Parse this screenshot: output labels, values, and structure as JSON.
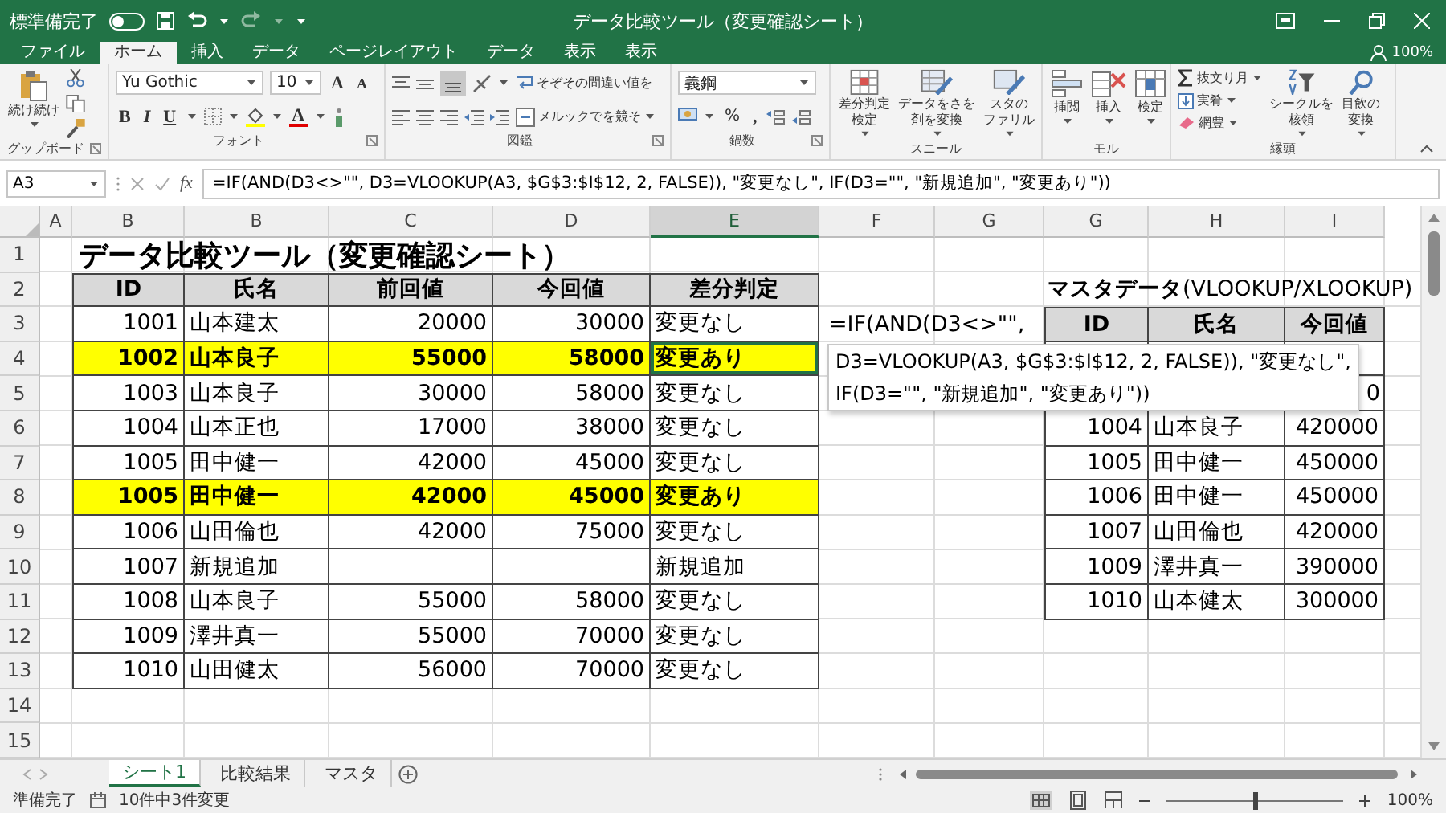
{
  "title_bar": {
    "autosave_label": "標準備完了",
    "autosave_on": false,
    "title": "データ比較ツール（変更確認シート）"
  },
  "ribbon_tabs": [
    {
      "label": "ファイル",
      "selected": false
    },
    {
      "label": "ホーム",
      "selected": true
    },
    {
      "label": "挿入",
      "selected": false
    },
    {
      "label": "データ",
      "selected": false
    },
    {
      "label": "ページレイアウト",
      "selected": false
    },
    {
      "label": "データ",
      "selected": false
    },
    {
      "label": "表示",
      "selected": false
    },
    {
      "label": "表示",
      "selected": false
    }
  ],
  "account_zoom": "100%",
  "ribbon": {
    "clipboard": {
      "label": "グップボード",
      "paste_label": "続け続け"
    },
    "font": {
      "label": "フォント",
      "font_name": "Yu Gothic",
      "font_size": "10",
      "grow": "A",
      "shrink": "A",
      "bold": "B",
      "italic": "I",
      "underline": "U",
      "font_color": "A"
    },
    "alignment": {
      "label": "図鑑",
      "wrap": "そぞその間違い値を",
      "merge": "メルックでを競そ"
    },
    "number": {
      "label": "鍋数",
      "format": "義鋼",
      "percent": "%",
      "comma": ","
    },
    "styles": {
      "label": "スニール",
      "buttons": [
        {
          "lines": [
            "差分判定",
            "検定"
          ]
        },
        {
          "lines": [
            "データをさを",
            "剤を変換"
          ]
        },
        {
          "lines": [
            "スタの",
            "ファリル"
          ]
        }
      ]
    },
    "cells": {
      "label": "モル",
      "buttons": [
        {
          "lines": [
            "挿閲"
          ]
        },
        {
          "lines": [
            "挿入"
          ]
        },
        {
          "lines": [
            "検定"
          ]
        }
      ]
    },
    "editing": {
      "label": "縁頭",
      "small": [
        "抜文り月",
        "実肴",
        "網豊"
      ],
      "buttons": [
        {
          "lines": [
            "シークルを",
            "核領"
          ]
        },
        {
          "lines": [
            "目飲の",
            "変換"
          ]
        }
      ]
    }
  },
  "formula_bar": {
    "name_box": "A3",
    "fx": "fx",
    "formula": "=IF(AND(D3<>\"\", D3=VLOOKUP(A3, $G$3:$I$12, 2, FALSE)), \"変更なし\", IF(D3=\"\", \"新規追加\", \"変更あり\"))"
  },
  "column_headers": [
    {
      "label": "A",
      "selected": false
    },
    {
      "label": "B",
      "selected": false
    },
    {
      "label": "B",
      "selected": false
    },
    {
      "label": "C",
      "selected": false
    },
    {
      "label": "D",
      "selected": false
    },
    {
      "label": "E",
      "selected": true
    },
    {
      "label": "F",
      "selected": false
    },
    {
      "label": "G",
      "selected": false
    },
    {
      "label": "G",
      "selected": false
    },
    {
      "label": "H",
      "selected": false
    },
    {
      "label": "I",
      "selected": false
    }
  ],
  "row_headers": [
    "1",
    "2",
    "3",
    "4",
    "5",
    "6",
    "7",
    "8",
    "9",
    "10",
    "11",
    "12",
    "13",
    "14",
    "15"
  ],
  "sheet_title": "データ比較ツール（変更確認シート）",
  "main_table": {
    "columns": [
      "ID",
      "氏名",
      "前回値",
      "今回値",
      "差分判定"
    ],
    "rows": [
      {
        "id": "1001",
        "name": "山本建太",
        "prev": "20000",
        "curr": "30000",
        "judgment": "変更なし",
        "highlighted": false,
        "active": false
      },
      {
        "id": "1002",
        "name": "山本良子",
        "prev": "55000",
        "curr": "58000",
        "judgment": "変更あり",
        "highlighted": true,
        "active": true
      },
      {
        "id": "1003",
        "name": "山本良子",
        "prev": "30000",
        "curr": "58000",
        "judgment": "変更なし",
        "highlighted": false,
        "active": false
      },
      {
        "id": "1004",
        "name": "山本正也",
        "prev": "17000",
        "curr": "38000",
        "judgment": "変更なし",
        "highlighted": false,
        "active": false
      },
      {
        "id": "1005",
        "name": "田中健一",
        "prev": "42000",
        "curr": "45000",
        "judgment": "変更なし",
        "highlighted": false,
        "active": false
      },
      {
        "id": "1005",
        "name": "田中健一",
        "prev": "42000",
        "curr": "45000",
        "judgment": "変更あり",
        "highlighted": true,
        "active": false
      },
      {
        "id": "1006",
        "name": "山田倫也",
        "prev": "42000",
        "curr": "75000",
        "judgment": "変更なし",
        "highlighted": false,
        "active": false
      },
      {
        "id": "1007",
        "name": "新規追加",
        "judgment": "新規追加",
        "highlighted": false,
        "active": false
      },
      {
        "id": "1008",
        "name": "山本良子",
        "prev": "55000",
        "curr": "58000",
        "judgment": "変更なし",
        "highlighted": false,
        "active": false
      },
      {
        "id": "1009",
        "name": "澤井真一",
        "prev": "55000",
        "curr": "70000",
        "judgment": "変更なし",
        "highlighted": false,
        "active": false
      },
      {
        "id": "1010",
        "name": "山田健太",
        "prev": "56000",
        "curr": "70000",
        "judgment": "変更なし",
        "highlighted": false,
        "active": false
      }
    ]
  },
  "cell_formula_text": "=IF(AND(D3<>\"\",",
  "formula_tooltip": {
    "lines": [
      "D3=VLOOKUP(A3, $G$3:$I$12, 2, FALSE)), \"変更なし\",",
      "IF(D3=\"\", \"新規追加\", \"変更あり\"))"
    ]
  },
  "master_table": {
    "title": "**マスタデータ**(VLOOKUP/XLOOKUP)",
    "columns": [
      "ID",
      "氏名",
      "今回値"
    ],
    "rows": [
      {
        "kind": "covered"
      },
      {
        "kind": "covered",
        "value": "0"
      },
      {
        "kind": "data",
        "id": "1004",
        "name": "山本良子",
        "value": "420000"
      },
      {
        "kind": "data",
        "id": "1005",
        "name": "田中健一",
        "value": "450000"
      },
      {
        "kind": "data",
        "id": "1006",
        "name": "田中健一",
        "value": "450000"
      },
      {
        "kind": "data",
        "id": "1007",
        "name": "山田倫也",
        "value": "420000"
      },
      {
        "kind": "data",
        "id": "1009",
        "name": "澤井真一",
        "value": "390000"
      },
      {
        "kind": "data",
        "id": "1010",
        "name": "山本健太",
        "value": "300000"
      }
    ]
  },
  "sheet_tabs": [
    {
      "label": "シート1",
      "selected": true
    },
    {
      "label": "比較結果",
      "selected": false
    },
    {
      "label": "マスタ",
      "selected": false
    }
  ],
  "status_bar": {
    "ready": "準備完了",
    "summary": "10件中3件変更",
    "zoom": {
      "level": 0.5,
      "label": "100%"
    }
  }
}
